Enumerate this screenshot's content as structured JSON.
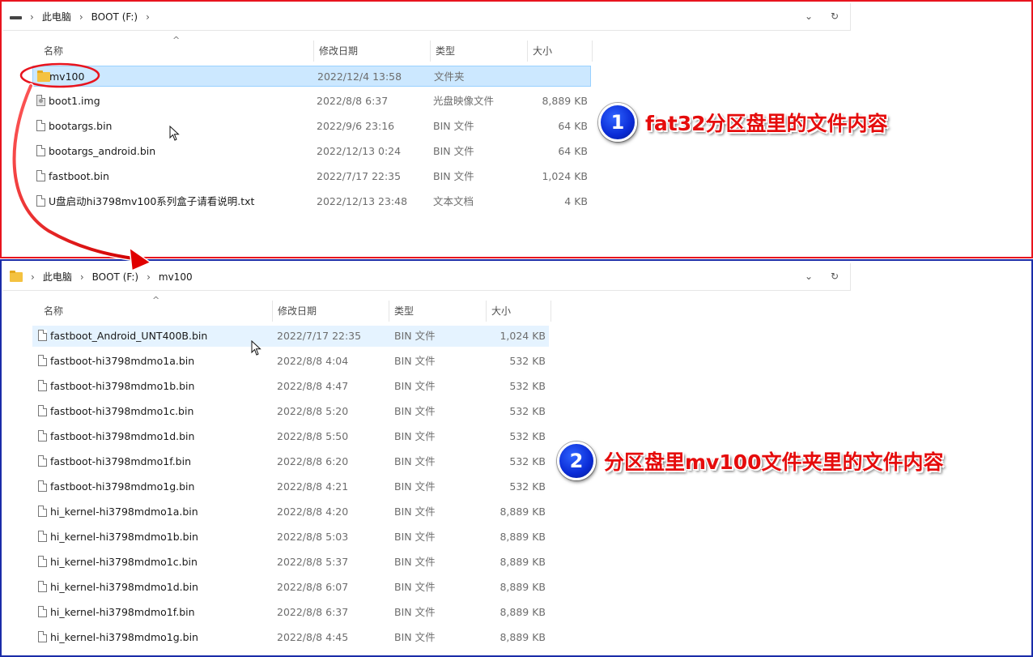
{
  "panel1": {
    "breadcrumb": [
      "此电脑",
      "BOOT (F:)"
    ],
    "columns": {
      "name": "名称",
      "date": "修改日期",
      "type": "类型",
      "size": "大小"
    },
    "rows": [
      {
        "icon": "folder-icon",
        "name": "mv100",
        "date": "2022/12/4 13:58",
        "type": "文件夹",
        "size": ""
      },
      {
        "icon": "disc-image-icon",
        "name": "boot1.img",
        "date": "2022/8/8 6:37",
        "type": "光盘映像文件",
        "size": "8,889 KB"
      },
      {
        "icon": "file-icon",
        "name": "bootargs.bin",
        "date": "2022/9/6 23:16",
        "type": "BIN 文件",
        "size": "64 KB"
      },
      {
        "icon": "file-icon",
        "name": "bootargs_android.bin",
        "date": "2022/12/13 0:24",
        "type": "BIN 文件",
        "size": "64 KB"
      },
      {
        "icon": "file-icon",
        "name": "fastboot.bin",
        "date": "2022/7/17 22:35",
        "type": "BIN 文件",
        "size": "1,024 KB"
      },
      {
        "icon": "text-file-icon",
        "name": "U盘启动hi3798mv100系列盒子请看说明.txt",
        "date": "2022/12/13 23:48",
        "type": "文本文档",
        "size": "4 KB"
      }
    ],
    "annotation": {
      "number": "1",
      "text": "fat32分区盘里的文件内容"
    }
  },
  "panel2": {
    "breadcrumb": [
      "此电脑",
      "BOOT (F:)",
      "mv100"
    ],
    "columns": {
      "name": "名称",
      "date": "修改日期",
      "type": "类型",
      "size": "大小"
    },
    "rows": [
      {
        "name": "fastboot_Android_UNT400B.bin",
        "date": "2022/7/17 22:35",
        "type": "BIN 文件",
        "size": "1,024 KB"
      },
      {
        "name": "fastboot-hi3798mdmo1a.bin",
        "date": "2022/8/8 4:04",
        "type": "BIN 文件",
        "size": "532 KB"
      },
      {
        "name": "fastboot-hi3798mdmo1b.bin",
        "date": "2022/8/8 4:47",
        "type": "BIN 文件",
        "size": "532 KB"
      },
      {
        "name": "fastboot-hi3798mdmo1c.bin",
        "date": "2022/8/8 5:20",
        "type": "BIN 文件",
        "size": "532 KB"
      },
      {
        "name": "fastboot-hi3798mdmo1d.bin",
        "date": "2022/8/8 5:50",
        "type": "BIN 文件",
        "size": "532 KB"
      },
      {
        "name": "fastboot-hi3798mdmo1f.bin",
        "date": "2022/8/8 6:20",
        "type": "BIN 文件",
        "size": "532 KB"
      },
      {
        "name": "fastboot-hi3798mdmo1g.bin",
        "date": "2022/8/8 4:21",
        "type": "BIN 文件",
        "size": "532 KB"
      },
      {
        "name": "hi_kernel-hi3798mdmo1a.bin",
        "date": "2022/8/8 4:20",
        "type": "BIN 文件",
        "size": "8,889 KB"
      },
      {
        "name": "hi_kernel-hi3798mdmo1b.bin",
        "date": "2022/8/8 5:03",
        "type": "BIN 文件",
        "size": "8,889 KB"
      },
      {
        "name": "hi_kernel-hi3798mdmo1c.bin",
        "date": "2022/8/8 5:37",
        "type": "BIN 文件",
        "size": "8,889 KB"
      },
      {
        "name": "hi_kernel-hi3798mdmo1d.bin",
        "date": "2022/8/8 6:07",
        "type": "BIN 文件",
        "size": "8,889 KB"
      },
      {
        "name": "hi_kernel-hi3798mdmo1f.bin",
        "date": "2022/8/8 6:37",
        "type": "BIN 文件",
        "size": "8,889 KB"
      },
      {
        "name": "hi_kernel-hi3798mdmo1g.bin",
        "date": "2022/8/8 4:45",
        "type": "BIN 文件",
        "size": "8,889 KB"
      }
    ],
    "annotation": {
      "number": "2",
      "text": "分区盘里mv100文件夹里的文件内容"
    }
  },
  "icons": {
    "address_controls": [
      "chevron-down-icon",
      "refresh-icon"
    ],
    "sort_indicator": "sort-up-icon"
  },
  "colors": {
    "panel1_border": "#e8141e",
    "panel2_border": "#1a2ca8",
    "selection": "#cce8ff",
    "annotation_text": "#e50c0c",
    "badge": "#0a2bd6"
  }
}
